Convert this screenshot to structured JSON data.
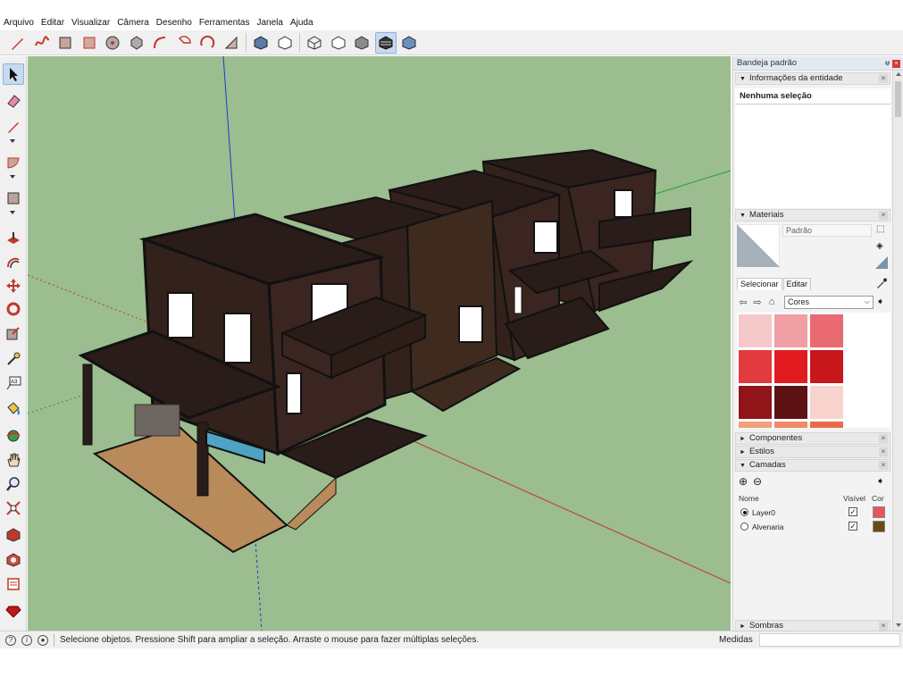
{
  "menu": [
    "Arquivo",
    "Editar",
    "Visualizar",
    "Câmera",
    "Desenho",
    "Ferramentas",
    "Janela",
    "Ajuda"
  ],
  "toolbar_top": [
    "pencil-icon",
    "freehand-icon",
    "rectangle-icon",
    "rotated-rectangle-icon",
    "circle-icon",
    "polygon-icon",
    "arc-icon",
    "pie-icon",
    "three-point-arc-icon",
    "two-point-arc-icon",
    "iso-view-icon",
    "top-view-icon",
    "xray-style-icon",
    "wireframe-style-icon",
    "shaded-style-icon",
    "textured-style-icon",
    "monochrome-style-icon"
  ],
  "toolbar_left": [
    "select-icon",
    "eraser-icon",
    "line-icon",
    "arc-icon",
    "rectangle-icon",
    "push-pull-icon",
    "offset-icon",
    "move-icon",
    "rotate-icon",
    "scale-icon",
    "tape-measure-icon",
    "text-icon",
    "paint-bucket-icon",
    "orbit-icon",
    "pan-icon",
    "zoom-icon",
    "zoom-extents-icon",
    "warehouse-icon",
    "extension-warehouse-icon",
    "send-to-layout-icon",
    "ruby-icon"
  ],
  "tray": {
    "title": "Bandeja padrão",
    "pin": "ᵾ",
    "entity_info": {
      "title": "Informações da entidade",
      "selection": "Nenhuma seleção"
    },
    "materials": {
      "title": "Materiais",
      "current_name": "Padrão",
      "tab_select": "Selecionar",
      "tab_edit": "Editar",
      "collection": "Cores",
      "swatches": [
        "#f5c8ca",
        "#f0a0a5",
        "#e96a70",
        "#e23b3f",
        "#e11b1f",
        "#c8171b",
        "#8f1519",
        "#5c1214",
        "#f8d3cd",
        "#f0a07a",
        "#ee8a6a",
        "#e86a4a"
      ]
    },
    "components": "Componentes",
    "styles": "Estilos",
    "layers": {
      "title": "Camadas",
      "col_name": "Nome",
      "col_visible": "Visível",
      "col_color": "Cor",
      "rows": [
        {
          "name": "Layer0",
          "active": true,
          "visible": "✓",
          "color": "#e8545a"
        },
        {
          "name": "Alvenaria",
          "active": false,
          "visible": "✓",
          "color": "#6b4a16"
        }
      ]
    },
    "shadows": "Sombras"
  },
  "status": {
    "message": "Selecione objetos. Pressione Shift para ampliar a seleção. Arraste o mouse para fazer múltiplas seleções.",
    "measures_label": "Medidas"
  },
  "colors": {
    "viewport": "#9bbd8f",
    "building": "#3a2520",
    "roof": "#2a1c18",
    "ground": "#b98a5a"
  }
}
